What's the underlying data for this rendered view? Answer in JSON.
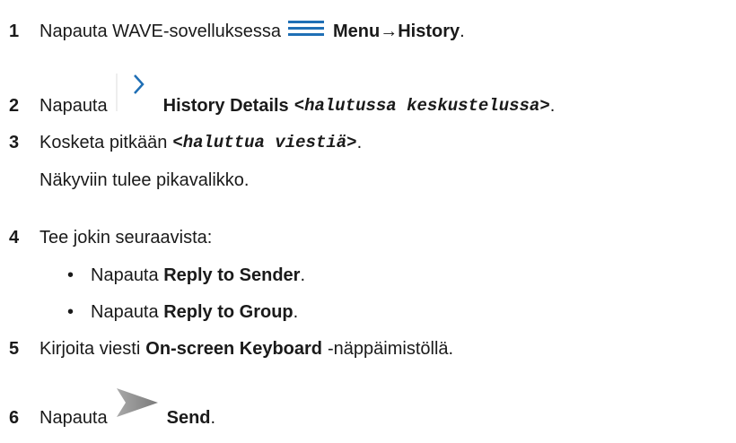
{
  "steps": [
    {
      "num": "1",
      "t1": "Napauta WAVE-sovelluksessa",
      "icon": "menu-icon",
      "bold": "Menu→History",
      "t2": "."
    },
    {
      "num": "2",
      "t1": "Napauta",
      "icon": "chevron-right-icon",
      "bold": "History Details",
      "mono": "<halutussa keskustelussa>",
      "t2": "."
    },
    {
      "num": "3",
      "t1": "Kosketa pitkään",
      "mono": "<haluttua viestiä>",
      "t2": ".",
      "note": "Näkyviin tulee pikavalikko."
    },
    {
      "num": "4",
      "t1": "Tee jokin seuraavista:",
      "bullets": [
        {
          "bullet": "•",
          "t1": "Napauta",
          "bold": "Reply to Sender",
          "t2": "."
        },
        {
          "bullet": "•",
          "t1": "Napauta",
          "bold": "Reply to Group",
          "t2": "."
        }
      ]
    },
    {
      "num": "5",
      "t1": "Kirjoita viesti",
      "bold": "On-screen Keyboard",
      "t2": "-näppäimistöllä."
    },
    {
      "num": "6",
      "t1": "Napauta",
      "icon": "send-icon",
      "bold": "Send",
      "t2": "."
    }
  ],
  "colors": {
    "text": "#1a1a1a",
    "icon_blue": "#1f6fb5",
    "icon_gray": "#8c8c8c"
  }
}
